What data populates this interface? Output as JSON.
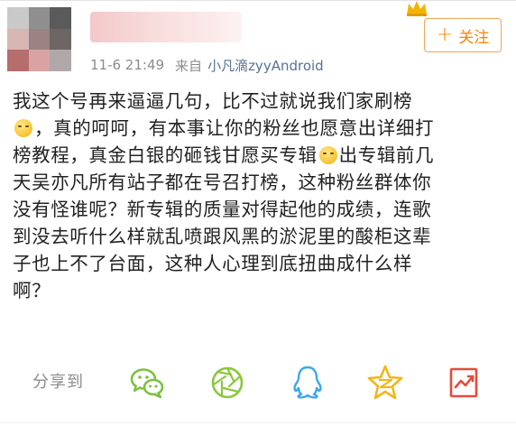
{
  "header": {
    "follow_button": {
      "label": "关注",
      "icon": "plus-icon"
    },
    "badge_icon": "verified-crown-icon"
  },
  "meta": {
    "timestamp": "11-6 21:49",
    "source_prefix": "来自",
    "source": "小凡滴zyyAndroid"
  },
  "post": {
    "lines": [
      "我这个号再来逼逼几句，比不过就说我们家刷榜",
      "，真的呵呵，有本事让你的粉丝也愿意出详细打",
      "榜教程，真金白银的砸钱甘愿买专辑",
      "出专辑前几",
      "天吴亦凡所有站子都在号召打榜，这种粉丝群体你",
      "没有怪谁呢？新专辑的质量对得起他的成绩，连歌",
      "到没去听什么样就乱喷跟风黑的淤泥里的酸柜这辈",
      "子也上不了台面，这种人心理到底扭曲成什么样",
      "啊？"
    ],
    "emoji_icon": "smile-emoji-icon"
  },
  "share": {
    "label": "分享到",
    "targets": [
      "wechat-icon",
      "moments-icon",
      "qq-icon",
      "qzone-icon",
      "weibo-share-icon"
    ]
  },
  "colors": {
    "accent_orange": "#ff8200",
    "follow_border": "#f0a65a",
    "icon_green": "#7cc13d",
    "icon_blue": "#3da7ea",
    "icon_gold": "#f2b51d",
    "icon_red": "#e64b3b",
    "meta_gray": "#8c8c8c",
    "source_link": "#57719a"
  }
}
